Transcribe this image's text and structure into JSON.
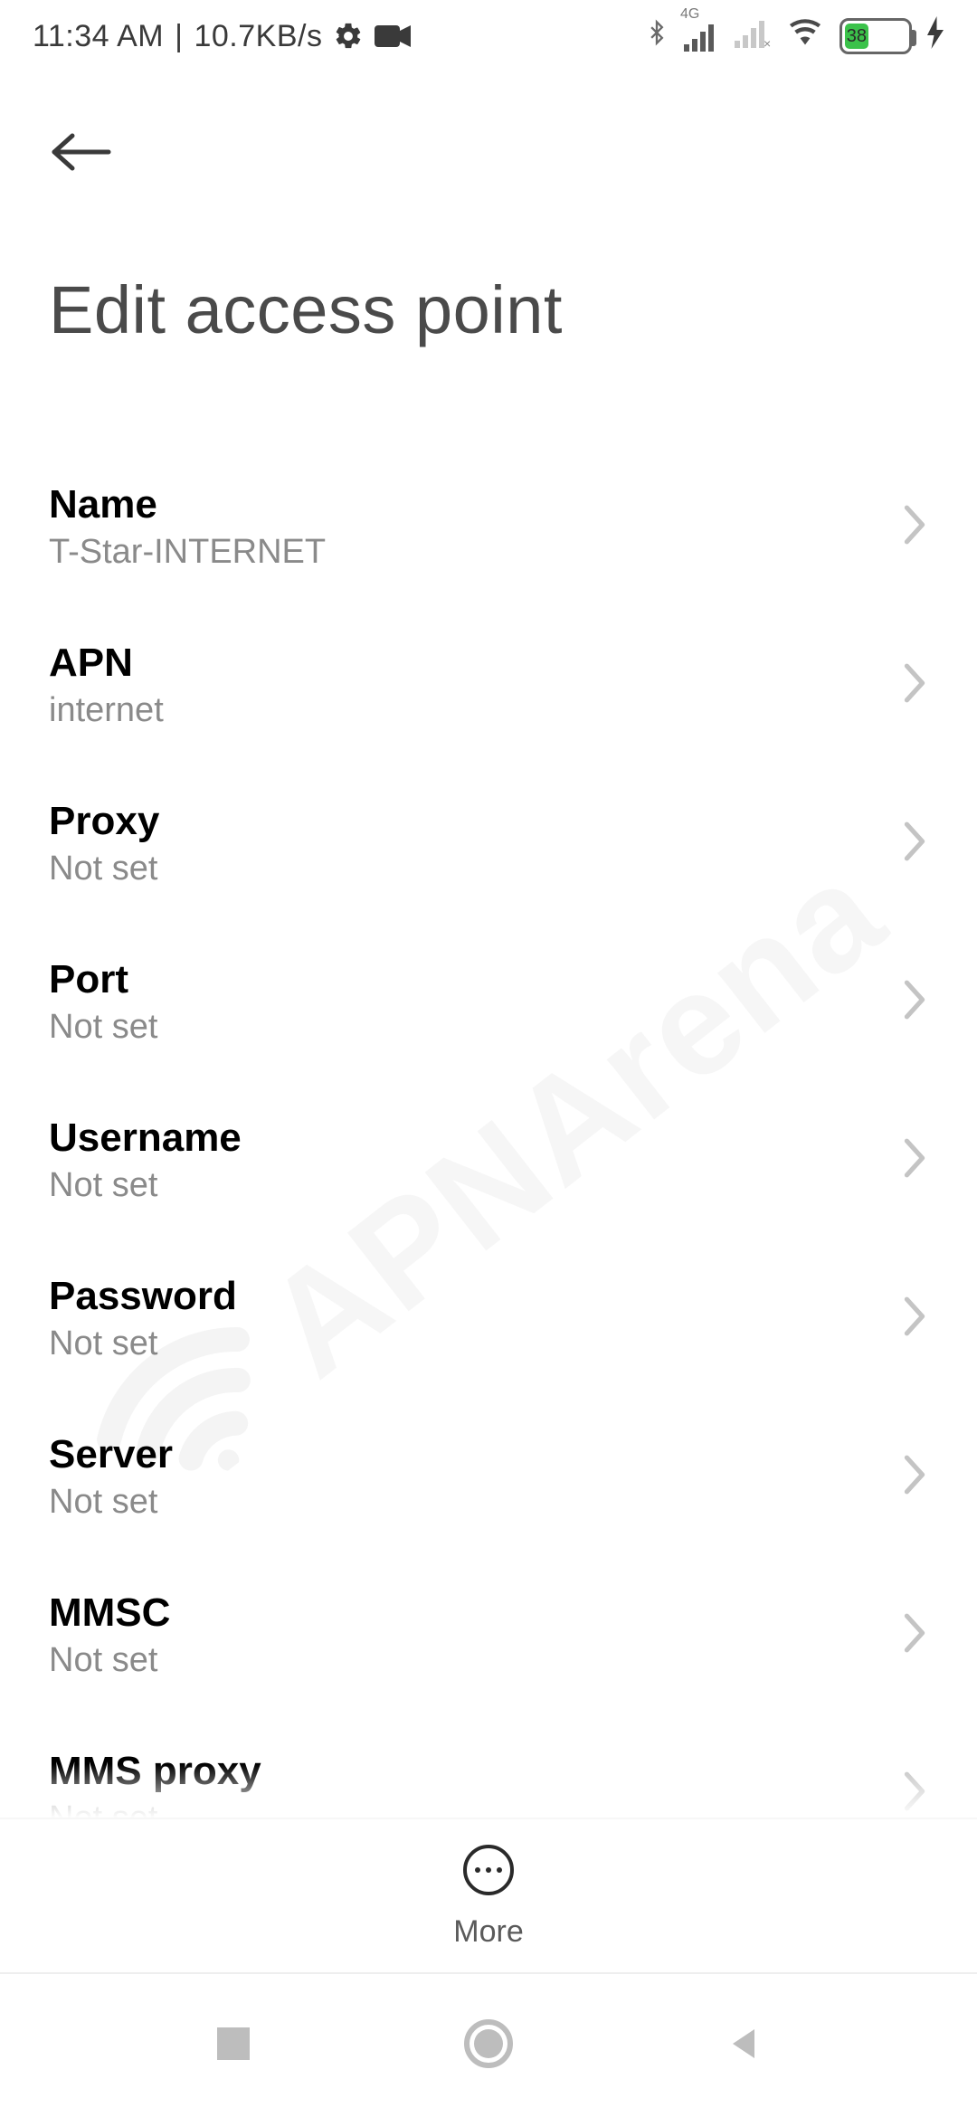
{
  "status": {
    "time": "11:34 AM",
    "separator": "|",
    "speed": "10.7KB/s",
    "network_label": "4G",
    "battery_percent": "38",
    "battery_fill_pct": 38
  },
  "header": {
    "title": "Edit access point"
  },
  "settings": [
    {
      "label": "Name",
      "value": "T-Star-INTERNET"
    },
    {
      "label": "APN",
      "value": "internet"
    },
    {
      "label": "Proxy",
      "value": "Not set"
    },
    {
      "label": "Port",
      "value": "Not set"
    },
    {
      "label": "Username",
      "value": "Not set"
    },
    {
      "label": "Password",
      "value": "Not set"
    },
    {
      "label": "Server",
      "value": "Not set"
    },
    {
      "label": "MMSC",
      "value": "Not set"
    },
    {
      "label": "MMS proxy",
      "value": "Not set"
    }
  ],
  "actionbar": {
    "more_label": "More"
  },
  "watermark": {
    "text": "APNArena"
  }
}
